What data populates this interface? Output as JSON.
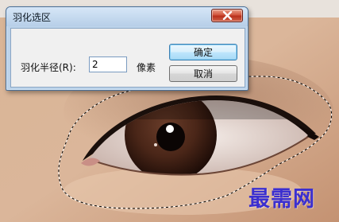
{
  "dialog": {
    "title": "羽化选区",
    "radius_label": "羽化半径(R):",
    "radius_value": "2",
    "unit_label": "像素",
    "ok_label": "确定",
    "cancel_label": "取消"
  },
  "watermark": "最需网",
  "colors": {
    "dialog_frame": "#bcd3ea",
    "close_button": "#c8412a",
    "watermark": "#3b2fd0",
    "skin": "#d7b08f"
  }
}
